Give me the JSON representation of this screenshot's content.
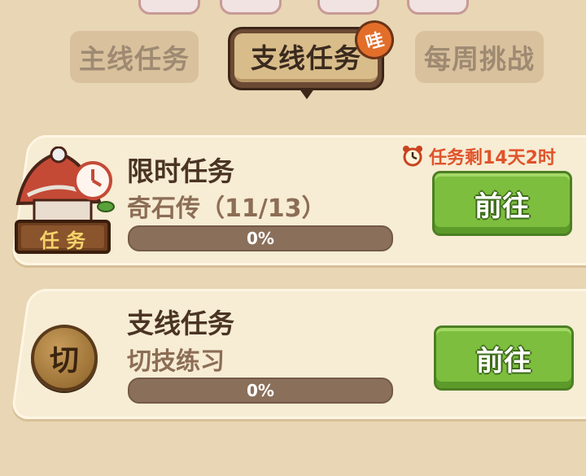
{
  "tabs": {
    "main": "主线任务",
    "side": "支线任务",
    "weekly": "每周挑战",
    "badge": "哇",
    "active": "side"
  },
  "tasks": [
    {
      "title": "限时任务",
      "subtitle": "奇石传（11/13）",
      "progress_text": "0%",
      "progress": 0,
      "timer": "任务剩14天2时",
      "button": "前往",
      "icon": "task-house-icon",
      "icon_label": "任 务"
    },
    {
      "title": "支线任务",
      "subtitle": "切技练习",
      "progress_text": "0%",
      "progress": 0,
      "button": "前往",
      "icon": "cut-coin-icon",
      "icon_label": "切"
    }
  ],
  "colors": {
    "background": "#e8d6b4",
    "card": "#f7ecd4",
    "button_green": "#7dbe3e",
    "timer_red": "#e0532b",
    "progress_track": "#8a6f5a"
  }
}
